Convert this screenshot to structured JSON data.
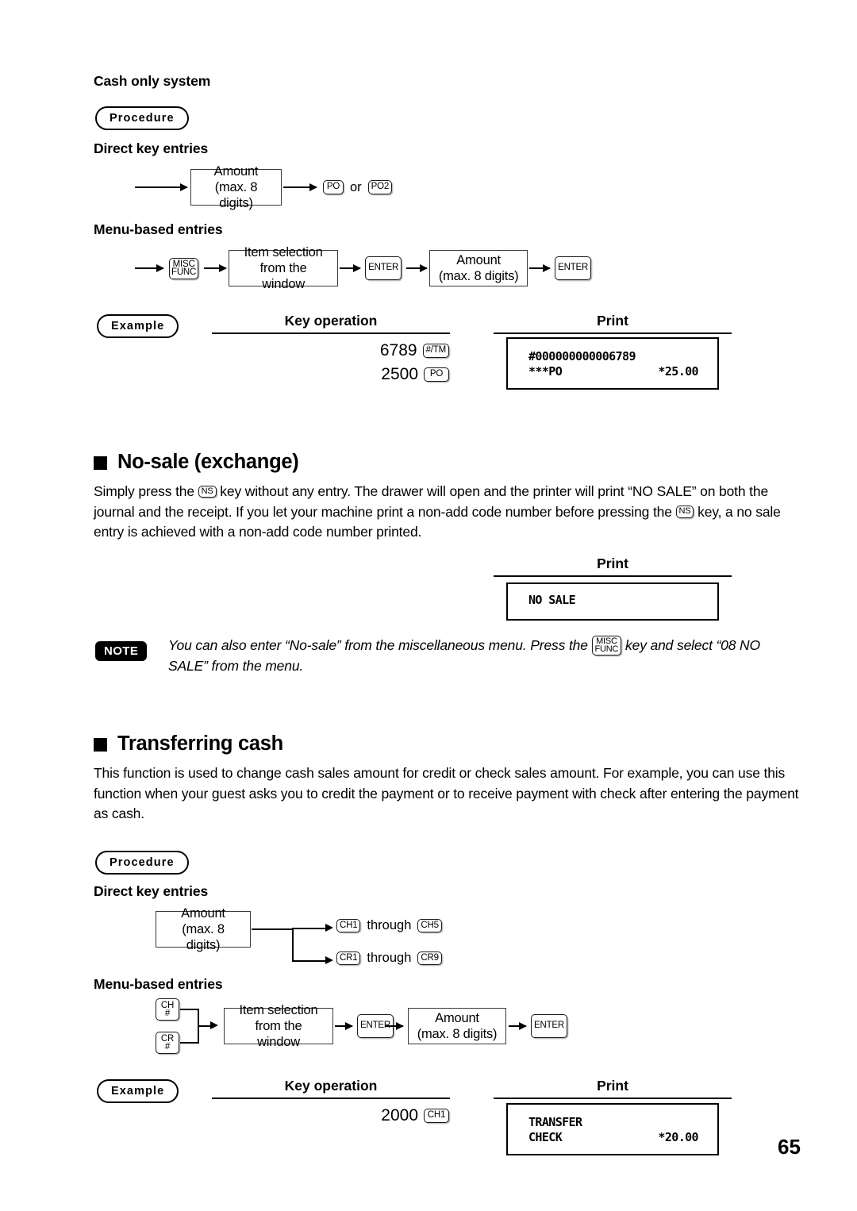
{
  "page": {
    "number": "65"
  },
  "cash_only": {
    "heading": "Cash only system",
    "procedure_label": "Procedure",
    "direct_label": "Direct key entries",
    "menu_label": "Menu-based entries",
    "direct_flow": {
      "amount_line1": "Amount",
      "amount_line2": "(max. 8 digits)",
      "key_po": "PO",
      "or_text": "or",
      "key_po2": "PO2"
    },
    "menu_flow": {
      "key_misc_line1": "MISC",
      "key_misc_line2": "FUNC",
      "item_line1": "Item selection",
      "item_line2": "from the window",
      "key_enter_1": "ENTER",
      "amount_line1": "Amount",
      "amount_line2": "(max. 8 digits)",
      "key_enter_2": "ENTER"
    },
    "example": {
      "label": "Example",
      "key_operation_header": "Key operation",
      "print_header": "Print",
      "keys": [
        {
          "amount": "6789",
          "key": "#/TM"
        },
        {
          "amount": "2500",
          "key": "PO"
        }
      ],
      "print": {
        "line1": "#000000000006789",
        "line2_label": "***PO",
        "line2_amount": "*25.00"
      }
    }
  },
  "no_sale": {
    "title": "No-sale (exchange)",
    "para": {
      "seg1": "Simply press the ",
      "key1": "NS",
      "seg2": " key without any entry.  The drawer will open and the printer will print “NO SALE” on both the journal and the receipt.  If you let your machine print a non-add code number before pressing the ",
      "key2": "NS",
      "seg3": " key, a no sale entry is achieved with a non-add code number printed."
    },
    "print_header": "Print",
    "print": {
      "line1": "NO SALE"
    },
    "note": {
      "badge": "NOTE",
      "seg1": "You can also enter “No-sale” from the miscellaneous menu.  Press the ",
      "key_line1": "MISC",
      "key_line2": "FUNC",
      "seg2": " key and select “08 NO SALE” from the menu."
    }
  },
  "transferring": {
    "title": "Transferring cash",
    "para": "This function is used to change cash sales amount for credit or check sales amount. For example, you can use this function when your guest asks you to credit the payment or to receive payment with check after entering the payment as cash.",
    "procedure_label": "Procedure",
    "direct_label": "Direct key entries",
    "menu_label": "Menu-based entries",
    "direct_flow": {
      "amount_line1": "Amount",
      "amount_line2": "(max. 8 digits)",
      "branch_top": {
        "from_key": "CH1",
        "through_text": "through",
        "to_key": "CH5"
      },
      "branch_bottom": {
        "from_key": "CR1",
        "through_text": "through",
        "to_key": "CR9"
      }
    },
    "menu_flow": {
      "key_ch_line1": "CH",
      "key_ch_line2": "#",
      "key_cr_line1": "CR",
      "key_cr_line2": "#",
      "item_line1": "Item selection",
      "item_line2": "from the window",
      "key_enter_1": "ENTER",
      "amount_line1": "Amount",
      "amount_line2": "(max. 8 digits)",
      "key_enter_2": "ENTER"
    },
    "example": {
      "label": "Example",
      "key_operation_header": "Key operation",
      "print_header": "Print",
      "keys": [
        {
          "amount": "2000",
          "key": "CH1"
        }
      ],
      "print": {
        "line1": "TRANSFER",
        "line2_label": "CHECK",
        "line2_amount": "*20.00"
      }
    }
  }
}
